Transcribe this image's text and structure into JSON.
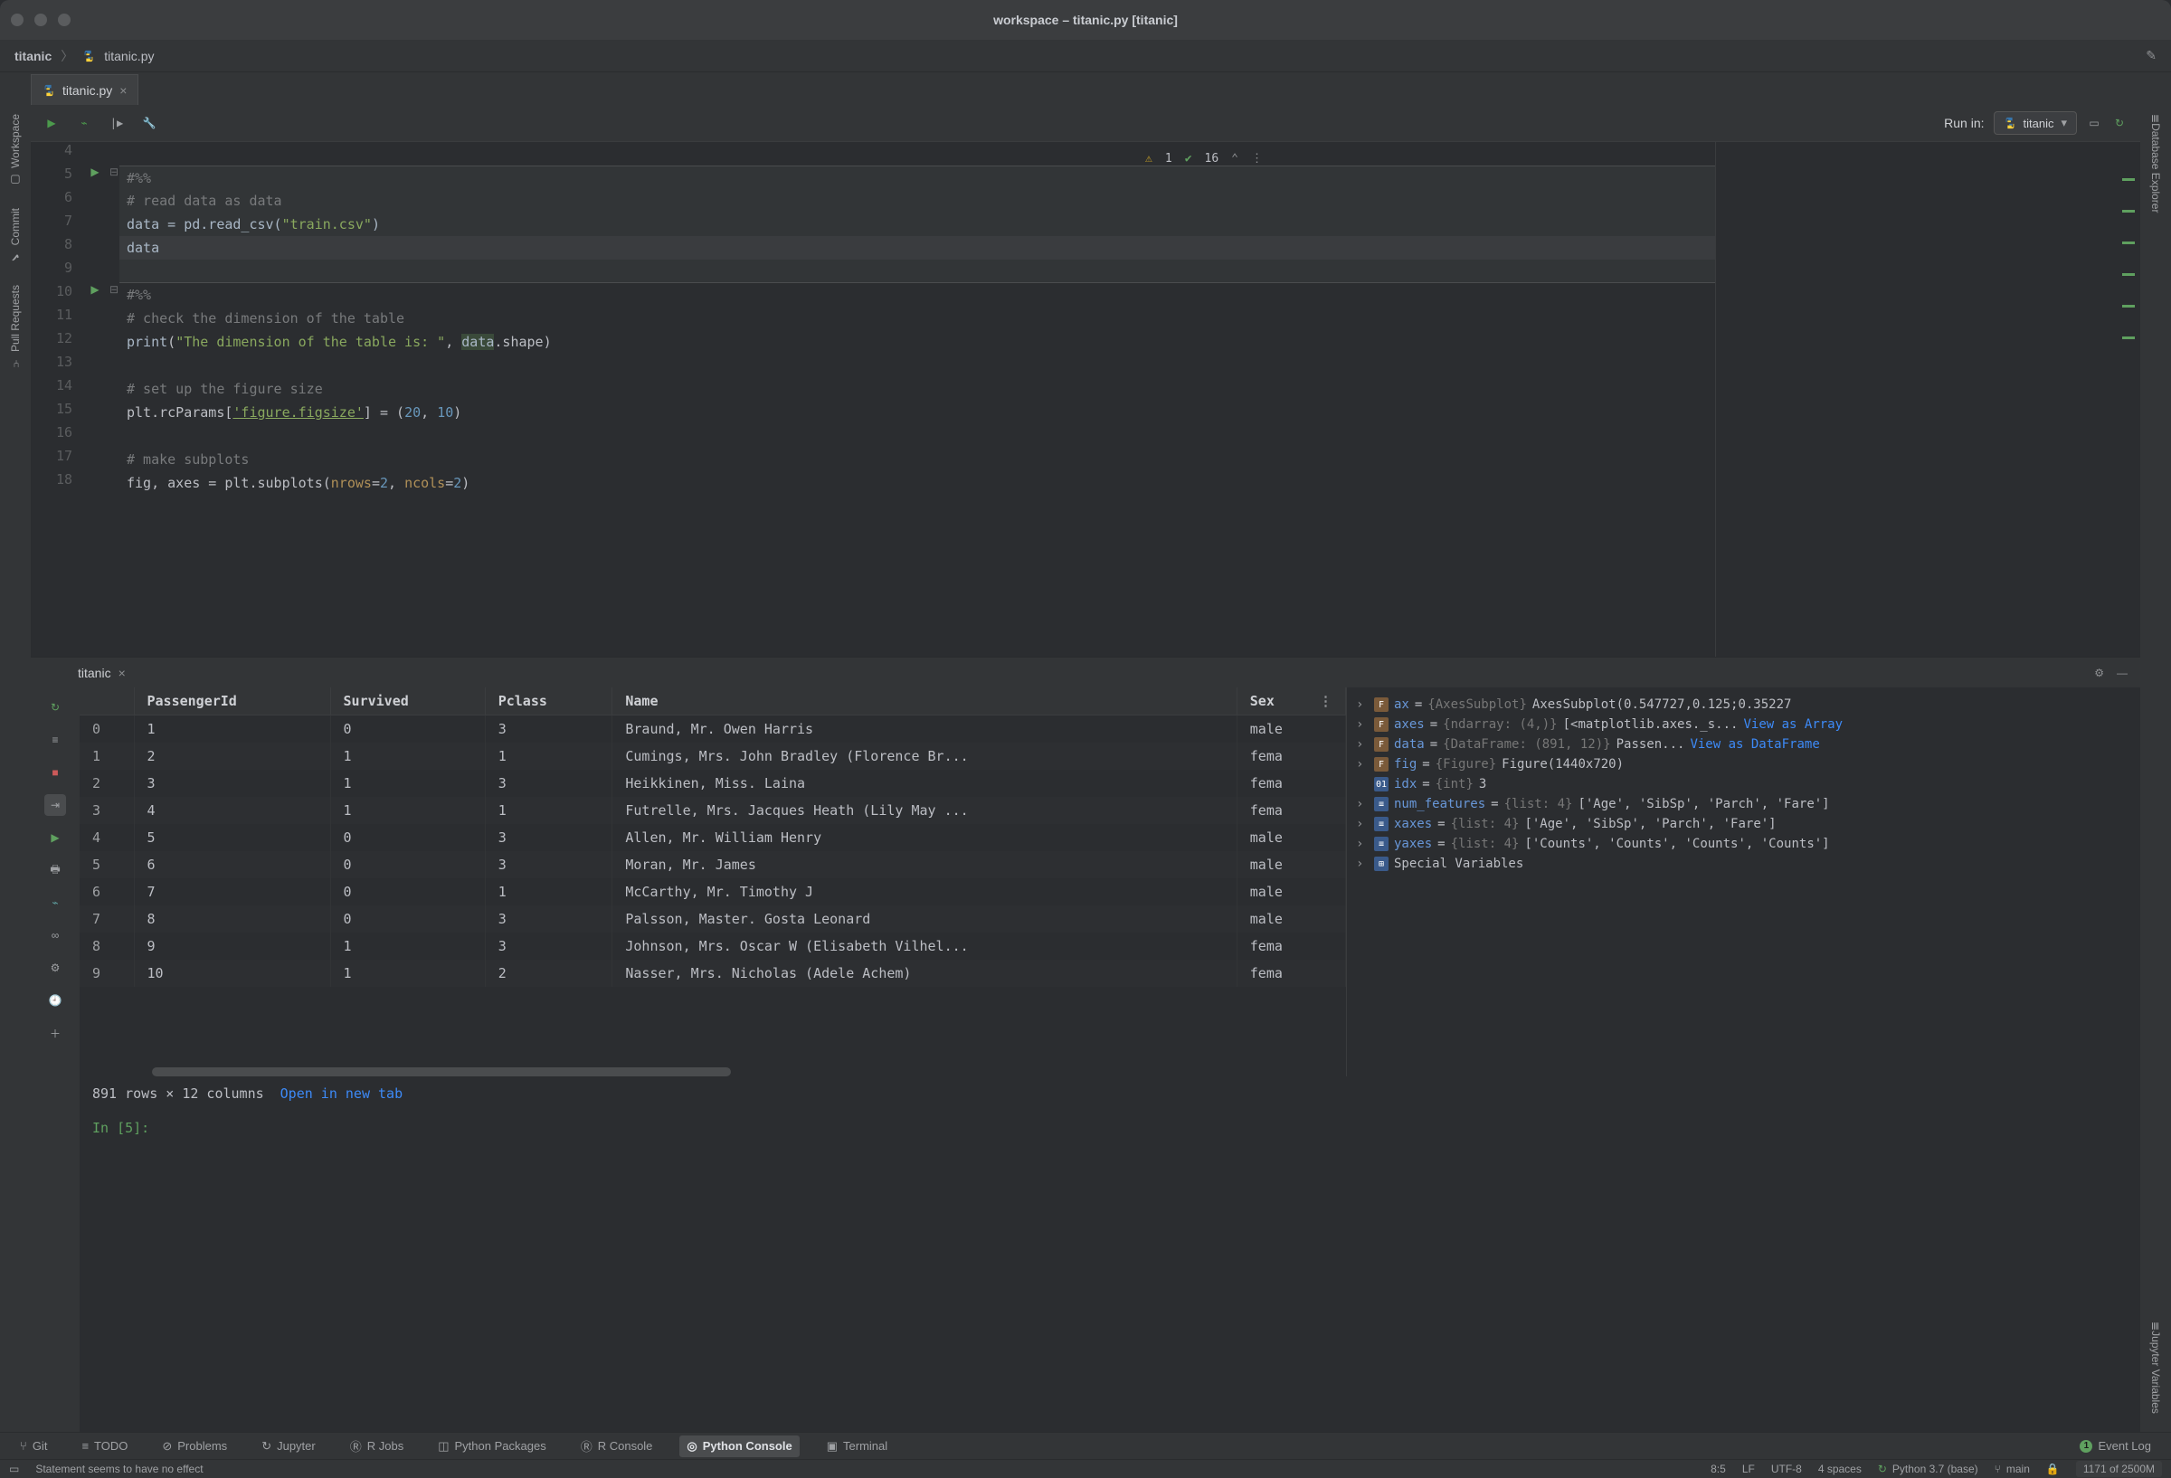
{
  "titlebar": {
    "title": "workspace – titanic.py [titanic]"
  },
  "breadcrumb": {
    "project": "titanic",
    "file": "titanic.py"
  },
  "file_tab": {
    "label": "titanic.py"
  },
  "left_tools": {
    "workspace": "Workspace",
    "commit": "Commit",
    "pull_requests": "Pull Requests"
  },
  "right_tools": {
    "db": "Database Explorer",
    "jupyter": "Jupyter Variables"
  },
  "run_in": {
    "label": "Run in:",
    "env": "titanic"
  },
  "inspections": {
    "warnings": "1",
    "passes": "16"
  },
  "code": {
    "l4": "",
    "l5": "#%%",
    "l6": "# read data as data",
    "l7a": "data",
    "l7b": " = pd.read_csv(",
    "l7c": "\"train.csv\"",
    "l7d": ")",
    "l8": "data",
    "l9": "",
    "l10": "#%%",
    "l11": "# check the dimension of the table",
    "l12a": "print",
    "l12b": "(",
    "l12c": "\"The dimension of the table is: \"",
    "l12d": ", ",
    "l12e": "data",
    "l12f": ".shape)",
    "l13": "",
    "l14": "# set up the figure size",
    "l15a": "plt.rcParams[",
    "l15b": "'figure.figsize'",
    "l15c": "] = (",
    "l15d": "20",
    "l15e": ", ",
    "l15f": "10",
    "l15g": ")",
    "l16": "",
    "l17": "# make subplots",
    "l18a": "fig, axes = plt.subplots(",
    "l18b": "nrows",
    "l18c": "=",
    "l18d": "2",
    "l18e": ", ",
    "l18f": "ncols",
    "l18g": "=",
    "l18h": "2",
    "l18i": ")"
  },
  "line_numbers": [
    "4",
    "5",
    "6",
    "7",
    "8",
    "9",
    "10",
    "11",
    "12",
    "13",
    "14",
    "15",
    "16",
    "17",
    "18"
  ],
  "panel_tab": {
    "label": "titanic"
  },
  "df": {
    "headers": [
      "",
      "PassengerId",
      "Survived",
      "Pclass",
      "Name",
      "Sex"
    ],
    "rows": [
      {
        "idx": "0",
        "pid": "1",
        "surv": "0",
        "pclass": "3",
        "name": "Braund, Mr. Owen Harris",
        "sex": "male"
      },
      {
        "idx": "1",
        "pid": "2",
        "surv": "1",
        "pclass": "1",
        "name": "Cumings, Mrs. John Bradley (Florence Br...",
        "sex": "fema"
      },
      {
        "idx": "2",
        "pid": "3",
        "surv": "1",
        "pclass": "3",
        "name": "Heikkinen, Miss. Laina",
        "sex": "fema"
      },
      {
        "idx": "3",
        "pid": "4",
        "surv": "1",
        "pclass": "1",
        "name": "Futrelle, Mrs. Jacques Heath (Lily May ...",
        "sex": "fema"
      },
      {
        "idx": "4",
        "pid": "5",
        "surv": "0",
        "pclass": "3",
        "name": "Allen, Mr. William Henry",
        "sex": "male"
      },
      {
        "idx": "5",
        "pid": "6",
        "surv": "0",
        "pclass": "3",
        "name": "Moran, Mr. James",
        "sex": "male"
      },
      {
        "idx": "6",
        "pid": "7",
        "surv": "0",
        "pclass": "1",
        "name": "McCarthy, Mr. Timothy J",
        "sex": "male"
      },
      {
        "idx": "7",
        "pid": "8",
        "surv": "0",
        "pclass": "3",
        "name": "Palsson, Master. Gosta Leonard",
        "sex": "male"
      },
      {
        "idx": "8",
        "pid": "9",
        "surv": "1",
        "pclass": "3",
        "name": "Johnson, Mrs. Oscar W (Elisabeth Vilhel...",
        "sex": "fema"
      },
      {
        "idx": "9",
        "pid": "10",
        "surv": "1",
        "pclass": "2",
        "name": "Nasser, Mrs. Nicholas (Adele Achem)",
        "sex": "fema"
      }
    ],
    "footer": "891 rows × 12 columns",
    "open_link": "Open in new tab",
    "prompt": "In [5]:"
  },
  "vars": {
    "ax": {
      "name": "ax",
      "type": "{AxesSubplot}",
      "val": "AxesSubplot(0.547727,0.125;0.35227"
    },
    "axes": {
      "name": "axes",
      "type": "{ndarray: (4,)}",
      "val": "[<matplotlib.axes._s...",
      "link": "View as Array"
    },
    "data": {
      "name": "data",
      "type": "{DataFrame: (891, 12)}",
      "val": "Passen...",
      "link": "View as DataFrame"
    },
    "fig": {
      "name": "fig",
      "type": "{Figure}",
      "val": "Figure(1440x720)"
    },
    "idx": {
      "name": "idx",
      "type": "{int}",
      "val": "3"
    },
    "num_features": {
      "name": "num_features",
      "type": "{list: 4}",
      "val": "['Age', 'SibSp', 'Parch', 'Fare']"
    },
    "xaxes": {
      "name": "xaxes",
      "type": "{list: 4}",
      "val": "['Age', 'SibSp', 'Parch', 'Fare']"
    },
    "yaxes": {
      "name": "yaxes",
      "type": "{list: 4}",
      "val": "['Counts', 'Counts', 'Counts', 'Counts']"
    },
    "special": {
      "name": "Special Variables"
    }
  },
  "bottom_tabs": {
    "git": "Git",
    "todo": "TODO",
    "problems": "Problems",
    "jupyter": "Jupyter",
    "rjobs": "R Jobs",
    "pypkg": "Python Packages",
    "rconsole": "R Console",
    "pyconsole": "Python Console",
    "terminal": "Terminal",
    "eventlog": "Event Log",
    "event_count": "1"
  },
  "status": {
    "msg": "Statement seems to have no effect",
    "pos": "8:5",
    "lf": "LF",
    "enc": "UTF-8",
    "indent": "4 spaces",
    "interp": "Python 3.7 (base)",
    "branch": "main",
    "mem": "1171 of 2500M"
  }
}
